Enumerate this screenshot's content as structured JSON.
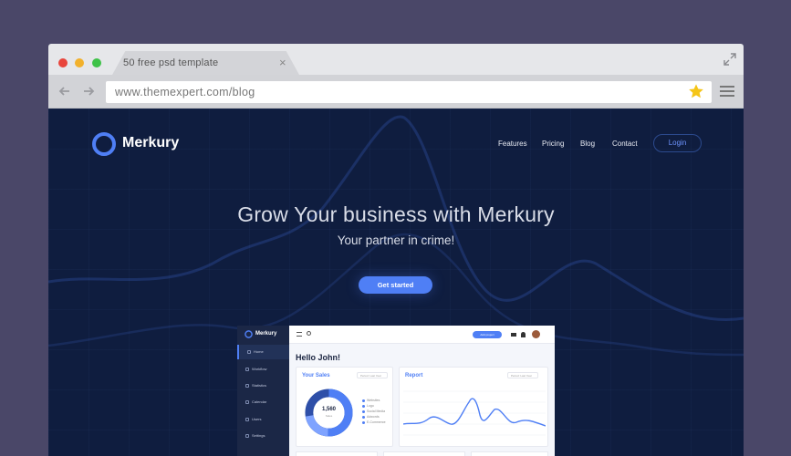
{
  "browser": {
    "tab_title": "50 free psd  template",
    "url": "www.themexpert.com/blog",
    "colors": {
      "red": "#e8453c",
      "yellow": "#f2b12c",
      "green": "#3ec248",
      "star": "#f5c518"
    }
  },
  "site": {
    "logo_text": "Merkury",
    "nav": [
      "Features",
      "Pricing",
      "Blog",
      "Contact"
    ],
    "login_label": "Login",
    "hero_title": "Grow Your business with Merkury",
    "hero_subtitle": "Your partner in crime!",
    "cta_label": "Get started",
    "accent": "#4f7ff5"
  },
  "dashboard": {
    "logo_text": "Merkury",
    "sidebar": [
      "Home",
      "Workflow",
      "Statistics",
      "Calendar",
      "Users",
      "Settings"
    ],
    "add_project_label": "Add project",
    "greeting": "Hello John!",
    "sales_title": "Your Sales",
    "sales_select": "Period: Last Year",
    "sales_total": "1,560",
    "sales_total_label": "Sales",
    "sales_legend": [
      "Websites",
      "Logo",
      "Social Media",
      "Adwords",
      "E-Commerce"
    ],
    "report_title": "Report",
    "report_select": "Period: Last Year"
  }
}
